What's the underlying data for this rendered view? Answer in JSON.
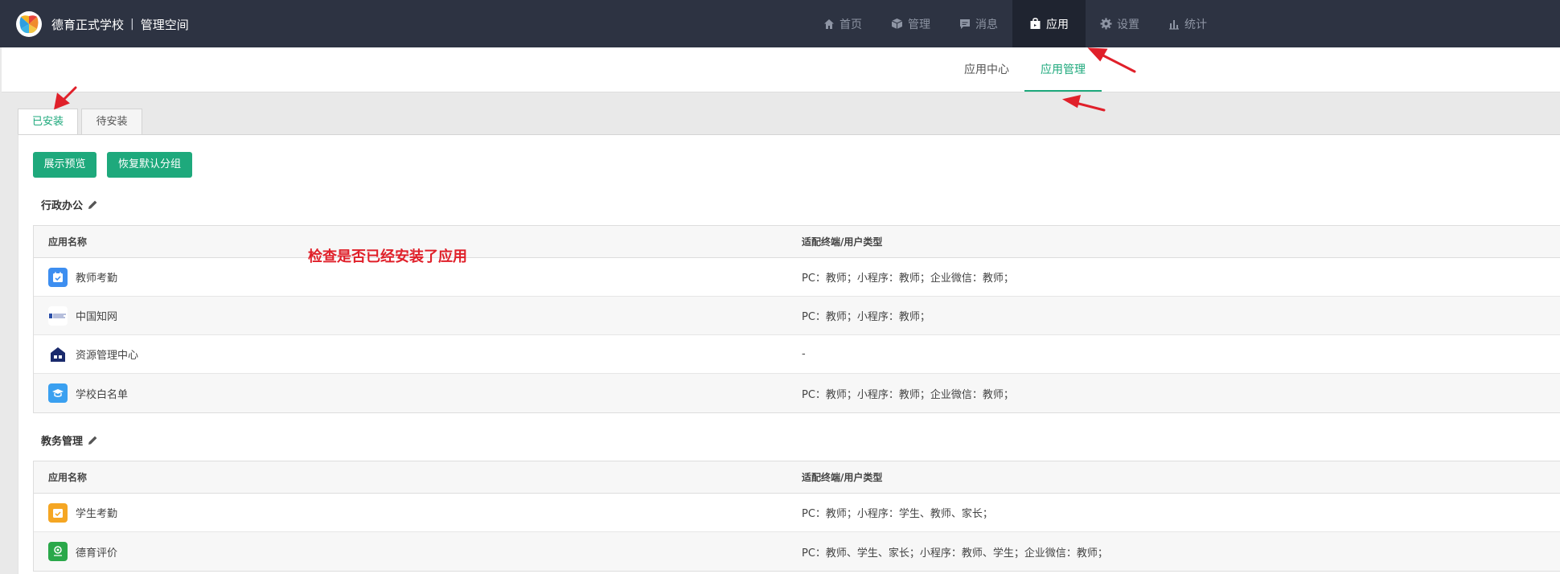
{
  "header": {
    "school_name": "德育正式学校",
    "separator": "|",
    "space_name": "管理空间",
    "nav": [
      {
        "label": "首页",
        "icon": "home-icon"
      },
      {
        "label": "管理",
        "icon": "cube-icon"
      },
      {
        "label": "消息",
        "icon": "message-icon"
      },
      {
        "label": "应用",
        "icon": "app-bag-icon",
        "active": true
      },
      {
        "label": "设置",
        "icon": "gear-icon"
      },
      {
        "label": "统计",
        "icon": "bar-chart-icon"
      }
    ]
  },
  "subnav": {
    "tabs": [
      {
        "label": "应用中心"
      },
      {
        "label": "应用管理",
        "active": true
      }
    ]
  },
  "install_tabs": [
    {
      "label": "已安装",
      "active": true
    },
    {
      "label": "待安装"
    }
  ],
  "actions": {
    "preview_label": "展示预览",
    "restore_label": "恢复默认分组"
  },
  "annotation": "检查是否已经安装了应用",
  "groups": [
    {
      "title": "行政办公",
      "headers": {
        "name": "应用名称",
        "terminals": "适配终端/用户类型"
      },
      "rows": [
        {
          "name": "教师考勤",
          "terminals": "PC：教师；小程序：教师；企业微信：教师；",
          "icon": "teacher-attendance-icon"
        },
        {
          "name": "中国知网",
          "terminals": "PC：教师；小程序：教师；",
          "icon": "cnki-icon"
        },
        {
          "name": "资源管理中心",
          "terminals": "-",
          "icon": "resource-center-icon"
        },
        {
          "name": "学校白名单",
          "terminals": "PC：教师；小程序：教师；企业微信：教师；",
          "icon": "school-whitelist-icon"
        }
      ]
    },
    {
      "title": "教务管理",
      "headers": {
        "name": "应用名称",
        "terminals": "适配终端/用户类型"
      },
      "rows": [
        {
          "name": "学生考勤",
          "terminals": "PC：教师；小程序：学生、教师、家长；",
          "icon": "student-attendance-icon"
        },
        {
          "name": "德育评价",
          "terminals": "PC：教师、学生、家长；小程序：教师、学生；企业微信：教师；",
          "icon": "moral-evaluation-icon"
        }
      ]
    }
  ],
  "colors": {
    "topbar": "#2d3342",
    "accent": "#1ea97c",
    "annotation": "#e0202a"
  }
}
